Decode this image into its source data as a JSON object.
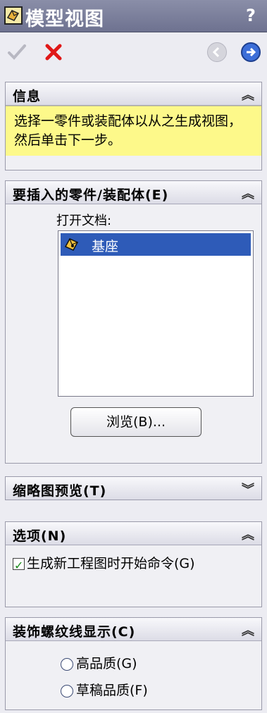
{
  "window": {
    "title": "模型视图",
    "help_label": "?"
  },
  "toolbar": {
    "ok_icon": "check-icon",
    "cancel_icon": "x-icon",
    "back_icon": "left-arrow-icon",
    "next_icon": "right-arrow-icon"
  },
  "info_panel": {
    "title": "信息",
    "message": "选择一零件或装配体以从之生成视图，然后单击下一步。"
  },
  "insert_panel": {
    "title": "要插入的零件/装配体(E)",
    "open_docs_label": "打开文档:",
    "documents": [
      {
        "name": "基座",
        "selected": true
      }
    ],
    "browse_label": "浏览(B)..."
  },
  "thumbnail_panel": {
    "title": "缩略图预览(T)"
  },
  "options_panel": {
    "title": "选项(N)",
    "start_command_label": "生成新工程图时开始命令(G)",
    "start_command_checked": true
  },
  "cosmetic_panel": {
    "title": "装饰螺纹线显示(C)",
    "options": [
      {
        "label": "高品质(G)",
        "selected": false
      },
      {
        "label": "草稿品质(F)",
        "selected": false
      }
    ]
  },
  "colors": {
    "selection": "#2e5bb8",
    "info_background": "#fdf98a",
    "title_bar": "#7c809c"
  }
}
